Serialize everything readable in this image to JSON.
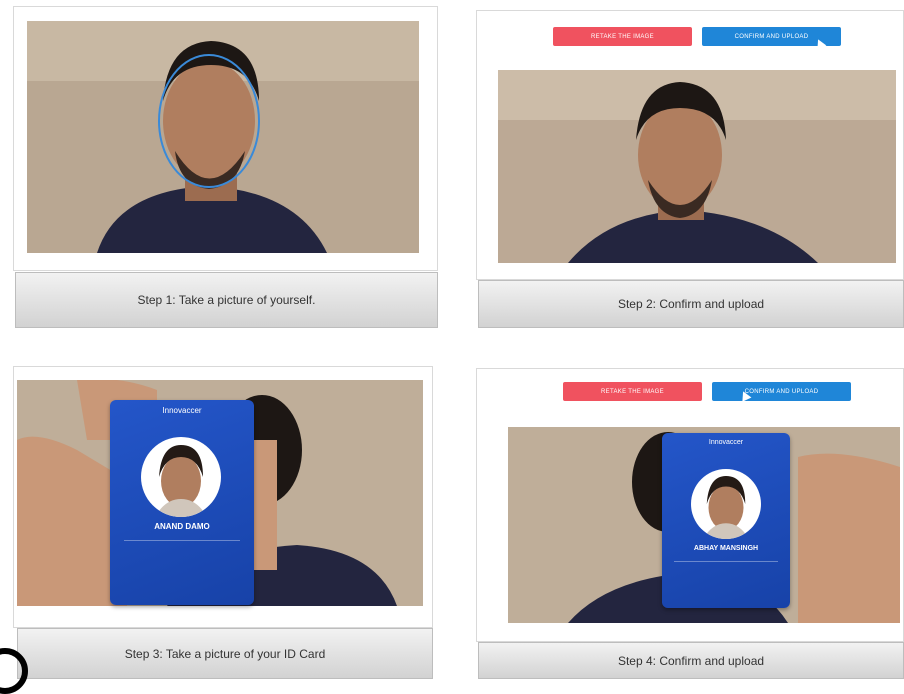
{
  "steps": [
    {
      "caption": "Step 1: Take a picture of yourself."
    },
    {
      "caption": "Step 2: Confirm and upload"
    },
    {
      "caption": "Step 3: Take a picture of your ID Card"
    },
    {
      "caption": "Step 4: Confirm and upload"
    }
  ],
  "buttons": {
    "retake": "RETAKE THE IMAGE",
    "confirm": "CONFIRM AND UPLOAD"
  },
  "id_card": {
    "brand": "Innovaccer",
    "name_a": "ANAND DAMO",
    "name_b": "ABHAY MANSINGH"
  },
  "colors": {
    "retake": "#f0525f",
    "confirm": "#1f86d8",
    "card": "#1b4fc2",
    "face_guide": "#3a8ad8"
  }
}
